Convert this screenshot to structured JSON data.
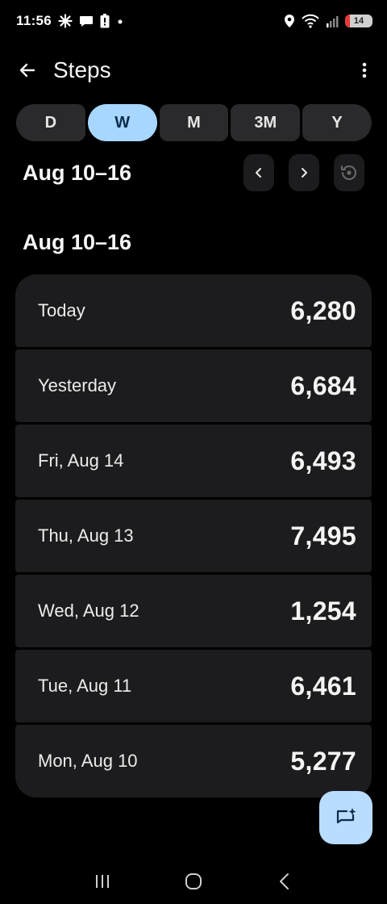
{
  "status_bar": {
    "time": "11:56",
    "battery_level": "14",
    "icons": [
      "pinwheel-icon",
      "chat-bubble-icon",
      "battery-alert-icon",
      "dot-icon",
      "location-icon",
      "wifi-icon",
      "signal-icon",
      "battery-icon"
    ]
  },
  "app_bar": {
    "title": "Steps"
  },
  "period_tabs": [
    {
      "label": "D",
      "active": false
    },
    {
      "label": "W",
      "active": true
    },
    {
      "label": "M",
      "active": false
    },
    {
      "label": "3M",
      "active": false
    },
    {
      "label": "Y",
      "active": false
    }
  ],
  "range": {
    "label": "Aug 10–16"
  },
  "section": {
    "title": "Aug 10–16"
  },
  "days": [
    {
      "label": "Today",
      "value": "6,280"
    },
    {
      "label": "Yesterday",
      "value": "6,684"
    },
    {
      "label": "Fri, Aug 14",
      "value": "6,493"
    },
    {
      "label": "Thu, Aug 13",
      "value": "7,495"
    },
    {
      "label": "Wed, Aug 12",
      "value": "1,254"
    },
    {
      "label": "Tue, Aug 11",
      "value": "6,461"
    },
    {
      "label": "Mon, Aug 10",
      "value": "5,277"
    }
  ],
  "colors": {
    "background": "#000000",
    "card": "#1c1c1e",
    "accent_tab": "#a7d6ff",
    "fab": "#b9dcff",
    "battery_low": "#e53935"
  }
}
